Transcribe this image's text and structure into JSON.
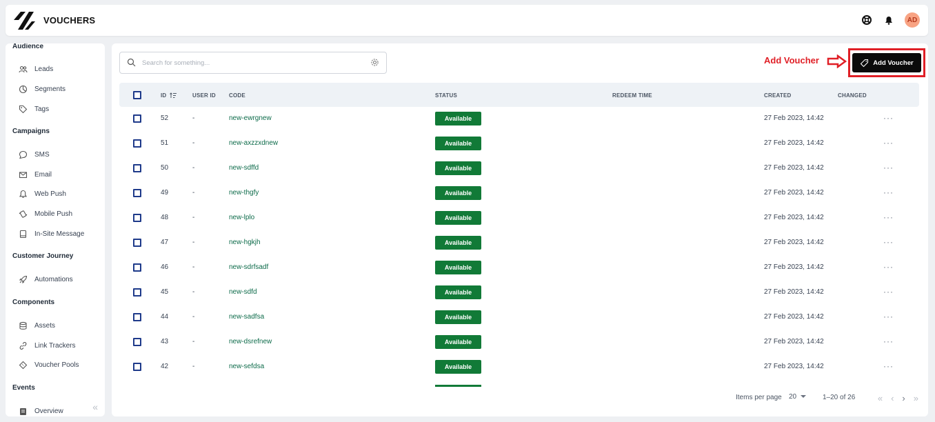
{
  "app": {
    "title": "VOUCHERS"
  },
  "header": {
    "avatar_initials": "AD"
  },
  "sidebar": {
    "sections": [
      {
        "title": "Audience",
        "items": [
          "Leads",
          "Segments",
          "Tags"
        ]
      },
      {
        "title": "Campaigns",
        "items": [
          "SMS",
          "Email",
          "Web Push",
          "Mobile Push",
          "In-Site Message"
        ]
      },
      {
        "title": "Customer Journey",
        "items": [
          "Automations"
        ]
      },
      {
        "title": "Components",
        "items": [
          "Assets",
          "Link Trackers",
          "Voucher Pools"
        ]
      },
      {
        "title": "Events",
        "items": [
          "Overview"
        ]
      }
    ]
  },
  "search": {
    "placeholder": "Search for something..."
  },
  "annotation": {
    "label": "Add Voucher",
    "color": "#e01f26"
  },
  "toolbar": {
    "add_label": "Add Voucher"
  },
  "table": {
    "headers": {
      "id": "ID",
      "user_id": "USER ID",
      "code": "CODE",
      "status": "STATUS",
      "redeem_time": "REDEEM TIME",
      "created": "CREATED",
      "changed": "CHANGED"
    },
    "rows": [
      {
        "id": "52",
        "user_id": "-",
        "code": "new-ewrgnew",
        "status": "Available",
        "created": "27 Feb 2023, 14:42"
      },
      {
        "id": "51",
        "user_id": "-",
        "code": "new-axzzxdnew",
        "status": "Available",
        "created": "27 Feb 2023, 14:42"
      },
      {
        "id": "50",
        "user_id": "-",
        "code": "new-sdffd",
        "status": "Available",
        "created": "27 Feb 2023, 14:42"
      },
      {
        "id": "49",
        "user_id": "-",
        "code": "new-thgfy",
        "status": "Available",
        "created": "27 Feb 2023, 14:42"
      },
      {
        "id": "48",
        "user_id": "-",
        "code": "new-lplo",
        "status": "Available",
        "created": "27 Feb 2023, 14:42"
      },
      {
        "id": "47",
        "user_id": "-",
        "code": "new-hgkjh",
        "status": "Available",
        "created": "27 Feb 2023, 14:42"
      },
      {
        "id": "46",
        "user_id": "-",
        "code": "new-sdrfsadf",
        "status": "Available",
        "created": "27 Feb 2023, 14:42"
      },
      {
        "id": "45",
        "user_id": "-",
        "code": "new-sdfd",
        "status": "Available",
        "created": "27 Feb 2023, 14:42"
      },
      {
        "id": "44",
        "user_id": "-",
        "code": "new-sadfsa",
        "status": "Available",
        "created": "27 Feb 2023, 14:42"
      },
      {
        "id": "43",
        "user_id": "-",
        "code": "new-dsrefnew",
        "status": "Available",
        "created": "27 Feb 2023, 14:42"
      },
      {
        "id": "42",
        "user_id": "-",
        "code": "new-sefdsa",
        "status": "Available",
        "created": "27 Feb 2023, 14:42"
      }
    ],
    "more_symbol": "···"
  },
  "pagination": {
    "items_per_page_label": "Items per page",
    "items_per_page": "20",
    "range": "1–20 of 26"
  },
  "colors": {
    "status_available": "#117a37",
    "code_link": "#0d6b4a",
    "checkbox": "#1e3a8a"
  }
}
